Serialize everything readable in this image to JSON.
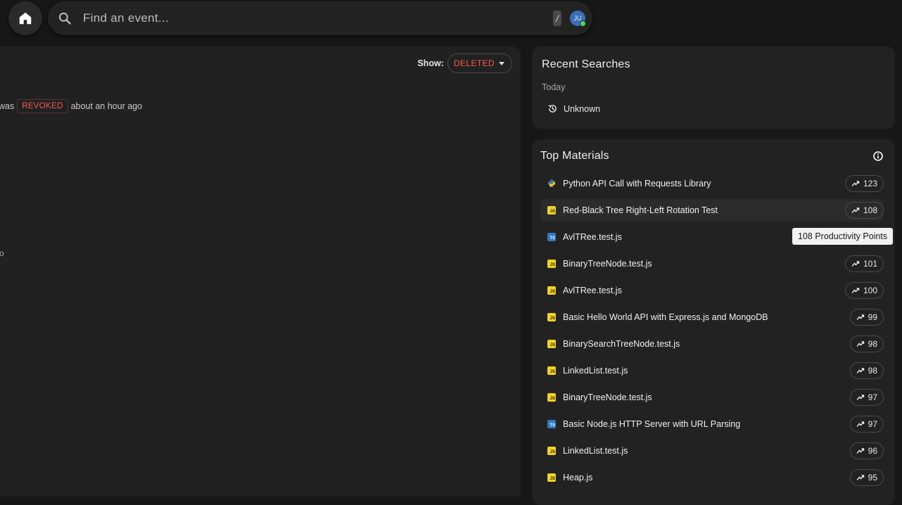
{
  "search": {
    "placeholder": "Find an event...",
    "shortcut_key": "/",
    "user_initials": "JU"
  },
  "filter": {
    "label": "Show:",
    "value": "DELETED"
  },
  "event": {
    "prefix": "was",
    "status": "REVOKED",
    "time": "about an hour ago"
  },
  "left_fragment": "o",
  "recent_searches": {
    "title": "Recent Searches",
    "group": "Today",
    "items": [
      {
        "label": "Unknown",
        "icon": "history-icon"
      }
    ]
  },
  "top_materials": {
    "title": "Top Materials",
    "items": [
      {
        "name": "Python API Call with Requests Library",
        "lang": "py",
        "points": "123"
      },
      {
        "name": "Red-Black Tree Right-Left Rotation Test",
        "lang": "js",
        "points": "108"
      },
      {
        "name": "AvlTRee.test.js",
        "lang": "ts",
        "points": ""
      },
      {
        "name": "BinaryTreeNode.test.js",
        "lang": "js",
        "points": "101"
      },
      {
        "name": "AvlTRee.test.js",
        "lang": "js",
        "points": "100"
      },
      {
        "name": "Basic Hello World API with Express.js and MongoDB",
        "lang": "js",
        "points": "99"
      },
      {
        "name": "BinarySearchTreeNode.test.js",
        "lang": "js",
        "points": "98"
      },
      {
        "name": "LinkedList.test.js",
        "lang": "js",
        "points": "98"
      },
      {
        "name": "BinaryTreeNode.test.js",
        "lang": "js",
        "points": "97"
      },
      {
        "name": "Basic Node.js HTTP Server with URL Parsing",
        "lang": "ts",
        "points": "97"
      },
      {
        "name": "LinkedList.test.js",
        "lang": "js",
        "points": "96"
      },
      {
        "name": "Heap.js",
        "lang": "js",
        "points": "95"
      }
    ]
  },
  "tooltip": "108 Productivity Points",
  "colors": {
    "accent_red": "#ff5b4f",
    "js_yellow": "#f0d22a",
    "ts_blue": "#3178c6",
    "online_green": "#4cd964"
  }
}
